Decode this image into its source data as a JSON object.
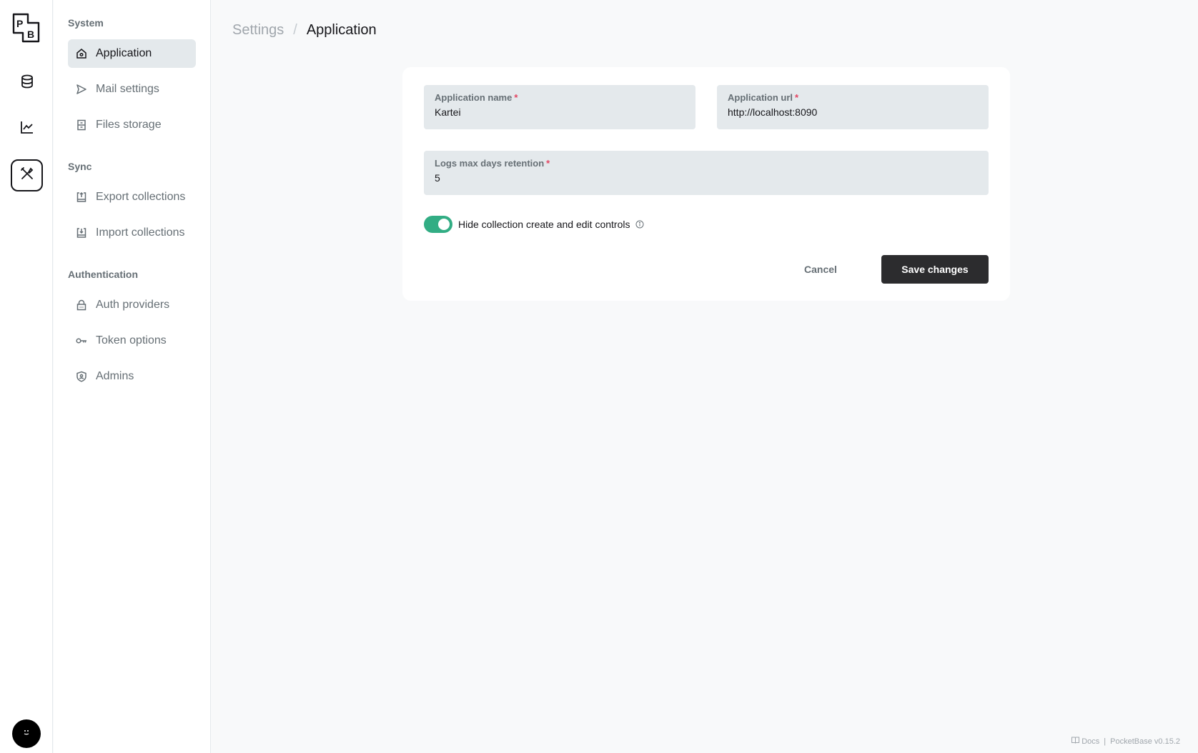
{
  "rail": {
    "logo_text": "PB",
    "items": [
      {
        "name": "collections",
        "icon": "database-icon"
      },
      {
        "name": "logs",
        "icon": "line-chart-icon"
      },
      {
        "name": "settings",
        "icon": "tools-icon",
        "active": true
      }
    ],
    "avatar_icon": "smiley-icon"
  },
  "sidebar": {
    "sections": [
      {
        "title": "System",
        "items": [
          {
            "label": "Application",
            "icon": "home-gear-icon",
            "active": true
          },
          {
            "label": "Mail settings",
            "icon": "send-icon"
          },
          {
            "label": "Files storage",
            "icon": "archive-icon"
          }
        ]
      },
      {
        "title": "Sync",
        "items": [
          {
            "label": "Export collections",
            "icon": "upload-icon"
          },
          {
            "label": "Import collections",
            "icon": "download-icon"
          }
        ]
      },
      {
        "title": "Authentication",
        "items": [
          {
            "label": "Auth providers",
            "icon": "lock-icon"
          },
          {
            "label": "Token options",
            "icon": "key-icon"
          },
          {
            "label": "Admins",
            "icon": "shield-user-icon"
          }
        ]
      }
    ]
  },
  "breadcrumb": {
    "parent": "Settings",
    "separator": "/",
    "current": "Application"
  },
  "form": {
    "app_name": {
      "label": "Application name",
      "required_mark": "*",
      "value": "Kartei"
    },
    "app_url": {
      "label": "Application url",
      "required_mark": "*",
      "value": "http://localhost:8090"
    },
    "logs_retention": {
      "label": "Logs max days retention",
      "required_mark": "*",
      "value": "5"
    },
    "hide_controls": {
      "label": "Hide collection create and edit controls",
      "checked": true
    },
    "cancel_label": "Cancel",
    "save_label": "Save changes"
  },
  "footer": {
    "docs_label": "Docs",
    "separator": "|",
    "version": "PocketBase v0.15.2"
  },
  "colors": {
    "accent_toggle": "#32ad84",
    "primary_button": "#2c2c2e",
    "required": "#e34562"
  }
}
